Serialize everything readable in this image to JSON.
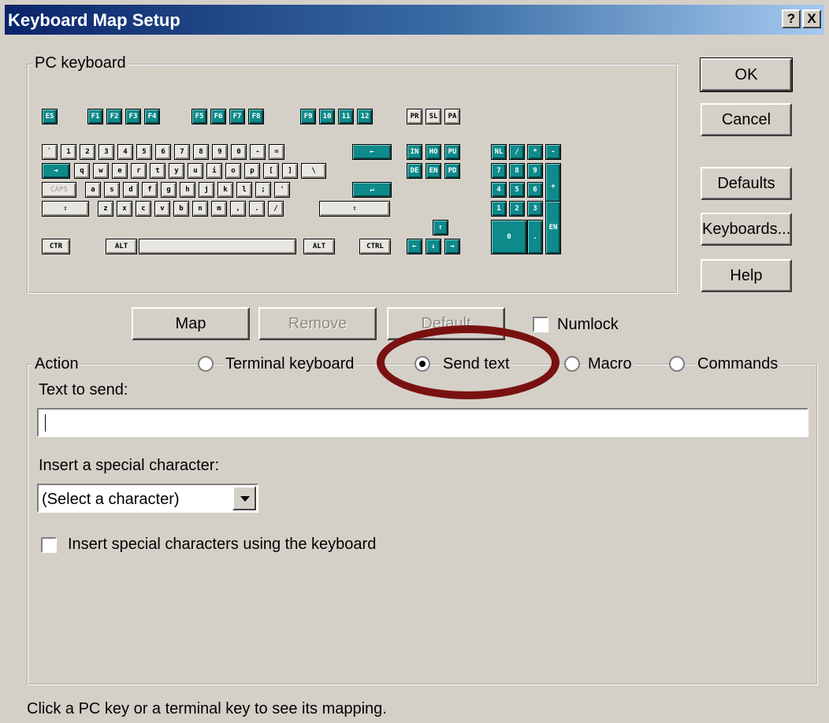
{
  "window": {
    "title": "Keyboard Map Setup",
    "help_button": "?",
    "close_button": "X"
  },
  "pc_keyboard": {
    "label": "PC keyboard",
    "keys": {
      "esc": "ES",
      "f1": "F1",
      "f2": "F2",
      "f3": "F3",
      "f4": "F4",
      "f5": "F5",
      "f6": "F6",
      "f7": "F7",
      "f8": "F8",
      "f9": "F9",
      "f10": "10",
      "f11": "11",
      "f12": "12",
      "prtsc": "PR",
      "scroll": "SL",
      "pause": "PA",
      "backtick": "`",
      "k1": "1",
      "k2": "2",
      "k3": "3",
      "k4": "4",
      "k5": "5",
      "k6": "6",
      "k7": "7",
      "k8": "8",
      "k9": "9",
      "k0": "0",
      "minus": "-",
      "equals": "=",
      "backspace": "←",
      "tab": "⇥",
      "q": "q",
      "w": "w",
      "e": "e",
      "r": "r",
      "t": "t",
      "y": "y",
      "u": "u",
      "i": "i",
      "o": "o",
      "p": "p",
      "lbracket": "[",
      "rbracket": "]",
      "backslash": "\\",
      "caps": "CAPS",
      "a": "a",
      "s": "s",
      "d": "d",
      "f": "f",
      "g": "g",
      "h": "h",
      "j": "j",
      "k": "k",
      "l": "l",
      "semicolon": ";",
      "quote": "'",
      "enter": "↵",
      "lshift": "⇧",
      "z": "z",
      "x": "x",
      "c": "c",
      "v": "v",
      "b": "b",
      "n": "n",
      "m": "m",
      "comma": ",",
      "period": ".",
      "slash": "/",
      "rshift": "⇧",
      "lctrl": "CTR",
      "lalt": "ALT",
      "space": "",
      "ralt": "ALT",
      "rctrl": "CTRL",
      "ins": "IN",
      "home": "HO",
      "pgup": "PU",
      "del": "DE",
      "end": "EN",
      "pgdn": "PD",
      "up": "↑",
      "left": "←",
      "down": "↓",
      "right": "→",
      "numlock": "NL",
      "numdiv": "/",
      "nummul": "*",
      "numsub": "-",
      "num7": "7",
      "num8": "8",
      "num9": "9",
      "numadd": "+",
      "num4": "4",
      "num5": "5",
      "num6": "6",
      "num1": "1",
      "num2": "2",
      "num3": "3",
      "numenter": "EN",
      "num0": "0",
      "numdot": "."
    }
  },
  "buttons": {
    "ok": "OK",
    "cancel": "Cancel",
    "defaults": "Defaults",
    "keyboards": "Keyboards...",
    "help": "Help",
    "map": "Map",
    "remove": "Remove",
    "default": "Default"
  },
  "numlock_checkbox": {
    "label": "Numlock",
    "checked": false
  },
  "action": {
    "label": "Action",
    "options": {
      "terminal_keyboard": "Terminal keyboard",
      "send_text": "Send text",
      "macro": "Macro",
      "commands": "Commands"
    },
    "selected": "Send text"
  },
  "text_to_send": {
    "label": "Text to send:",
    "value": ""
  },
  "special_character": {
    "label": "Insert a special character:",
    "selected": "(Select a character)"
  },
  "keyboard_special_checkbox": {
    "label": "Insert special characters using the keyboard",
    "checked": false
  },
  "status_text": "Click a PC key or a terminal key to see its mapping.",
  "colors": {
    "teal_key": "#0f8a8a",
    "highlight_ellipse": "#7a1111",
    "title_start": "#0a246a"
  }
}
